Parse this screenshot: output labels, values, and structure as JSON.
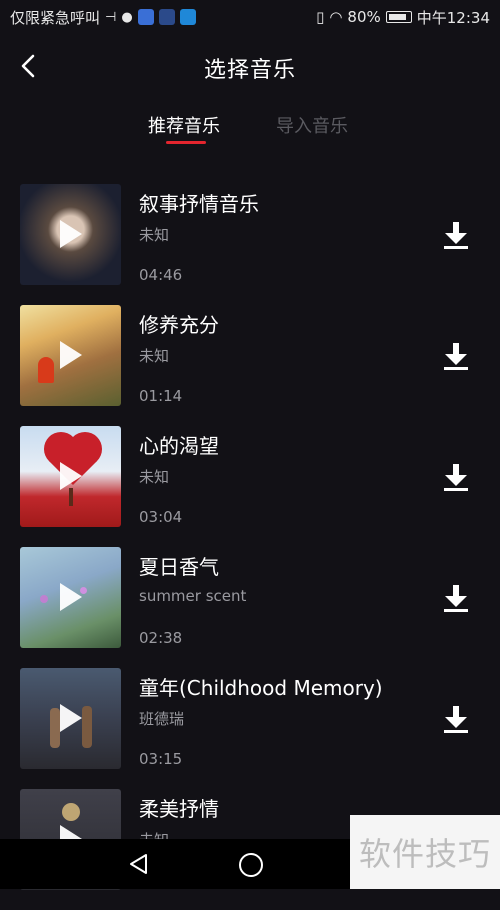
{
  "status_bar": {
    "carrier_text": "仅限紧急呼叫",
    "battery": "80%",
    "time": "中午12:34"
  },
  "header": {
    "title": "选择音乐"
  },
  "tabs": [
    {
      "label": "推荐音乐",
      "active": true
    },
    {
      "label": "导入音乐",
      "active": false
    }
  ],
  "songs": [
    {
      "title": "叙事抒情音乐",
      "artist": "未知",
      "duration": "04:46"
    },
    {
      "title": "修养充分",
      "artist": "未知",
      "duration": "01:14"
    },
    {
      "title": "心的渴望",
      "artist": "未知",
      "duration": "03:04"
    },
    {
      "title": "夏日香气",
      "artist": "summer scent",
      "duration": "02:38"
    },
    {
      "title": "童年(Childhood Memory)",
      "artist": "班德瑞",
      "duration": "03:15"
    },
    {
      "title": "柔美抒情",
      "artist": "未知",
      "duration": ""
    }
  ],
  "watermark": "软件技巧",
  "colors": {
    "background": "#121116",
    "tab_underline": "#e4252e",
    "secondary_text": "#9a9aa0"
  }
}
